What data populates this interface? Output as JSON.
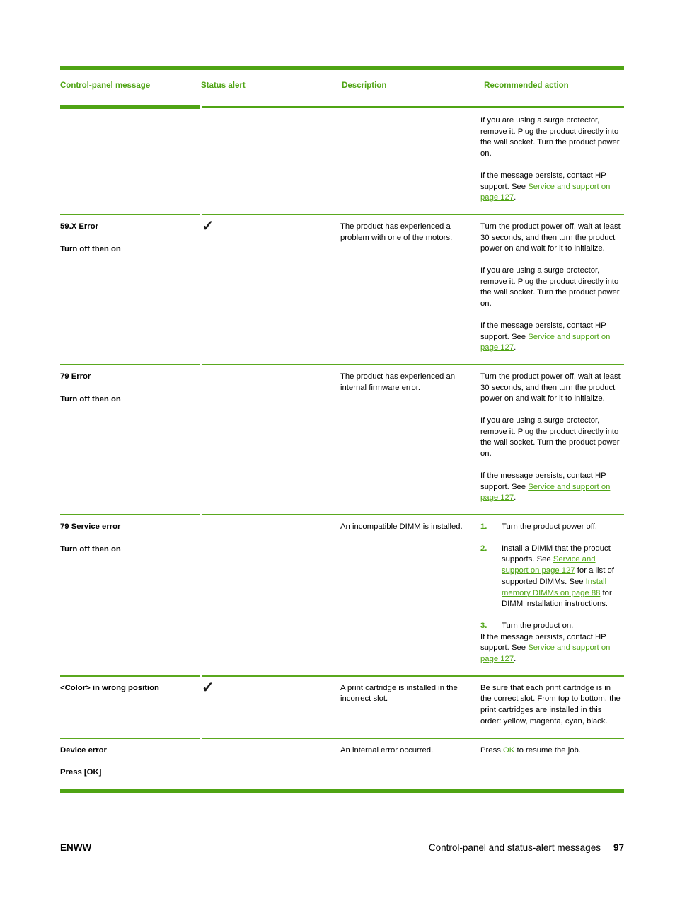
{
  "theme": {
    "accent": "#4FA414",
    "text": "#000000"
  },
  "table": {
    "headers": [
      "Control-panel message",
      "Status alert",
      "Description",
      "Recommended action"
    ],
    "rows": [
      {
        "message_lines": [],
        "status_alert": "",
        "description": "",
        "action_paragraphs": [
          {
            "parts": [
              {
                "t": "If you are using a surge protector, remove it. Plug the product directly into the wall socket. Turn the product power on.",
                "k": "text"
              }
            ]
          },
          {
            "parts": [
              {
                "t": "If the message persists, contact HP support. See ",
                "k": "text"
              },
              {
                "t": "Service and support on page 127",
                "k": "link"
              },
              {
                "t": ".",
                "k": "text"
              }
            ]
          }
        ]
      },
      {
        "message_lines": [
          "59.X Error",
          "Turn off then on"
        ],
        "status_alert": "✓",
        "description": "The product has experienced a problem with one of the motors.",
        "action_paragraphs": [
          {
            "parts": [
              {
                "t": "Turn the product power off, wait at least 30 seconds, and then turn the product power on and wait for it to initialize.",
                "k": "text"
              }
            ]
          },
          {
            "parts": [
              {
                "t": "If you are using a surge protector, remove it. Plug the product directly into the wall socket. Turn the product power on.",
                "k": "text"
              }
            ]
          },
          {
            "parts": [
              {
                "t": "If the message persists, contact HP support. See ",
                "k": "text"
              },
              {
                "t": "Service and support on page 127",
                "k": "link"
              },
              {
                "t": ".",
                "k": "text"
              }
            ]
          }
        ]
      },
      {
        "message_lines": [
          "79 Error",
          "Turn off then on"
        ],
        "status_alert": "",
        "description": "The product has experienced an internal firmware error.",
        "action_paragraphs": [
          {
            "parts": [
              {
                "t": "Turn the product power off, wait at least 30 seconds, and then turn the product power on and wait for it to initialize.",
                "k": "text"
              }
            ]
          },
          {
            "parts": [
              {
                "t": "If you are using a surge protector, remove it. Plug the product directly into the wall socket. Turn the product power on.",
                "k": "text"
              }
            ]
          },
          {
            "parts": [
              {
                "t": "If the message persists, contact HP support. See ",
                "k": "text"
              },
              {
                "t": "Service and support on page 127",
                "k": "link"
              },
              {
                "t": ".",
                "k": "text"
              }
            ]
          }
        ]
      },
      {
        "message_lines": [
          "79 Service error",
          "Turn off then on"
        ],
        "status_alert": "",
        "description": "An incompatible DIMM is installed.",
        "steps": [
          {
            "num": "1.",
            "parts": [
              {
                "t": "Turn the product power off.",
                "k": "text"
              }
            ]
          },
          {
            "num": "2.",
            "parts": [
              {
                "t": "Install a DIMM that the product supports. See ",
                "k": "text"
              },
              {
                "t": "Service and support on page 127",
                "k": "link"
              },
              {
                "t": " for a list of supported DIMMs. See ",
                "k": "text"
              },
              {
                "t": "Install memory DIMMs on page 88",
                "k": "link"
              },
              {
                "t": " for DIMM installation instructions.",
                "k": "text"
              }
            ]
          },
          {
            "num": "3.",
            "parts": [
              {
                "t": "Turn the product on.",
                "k": "text"
              }
            ]
          }
        ],
        "action_paragraphs": [
          {
            "parts": [
              {
                "t": "If the message persists, contact HP support. See ",
                "k": "text"
              },
              {
                "t": "Service and support on page 127",
                "k": "link"
              },
              {
                "t": ".",
                "k": "text"
              }
            ]
          }
        ]
      },
      {
        "message_lines": [
          "<Color> in wrong position"
        ],
        "status_alert": "✓",
        "description": "A print cartridge is installed in the incorrect slot.",
        "action_paragraphs": [
          {
            "parts": [
              {
                "t": "Be sure that each print cartridge is in the correct slot. From top to bottom, the print cartridges are installed in this order: yellow, magenta, cyan, black.",
                "k": "text"
              }
            ]
          }
        ]
      },
      {
        "message_lines": [
          "Device error",
          "Press [OK]"
        ],
        "status_alert": "",
        "description": "An internal error occurred.",
        "action_paragraphs": [
          {
            "parts": [
              {
                "t": "Press ",
                "k": "text"
              },
              {
                "t": "OK",
                "k": "green"
              },
              {
                "t": " to resume the job.",
                "k": "text"
              }
            ]
          }
        ]
      }
    ]
  },
  "footer": {
    "left": "ENWW",
    "section": "Control-panel and status-alert messages",
    "page_number": "97"
  }
}
